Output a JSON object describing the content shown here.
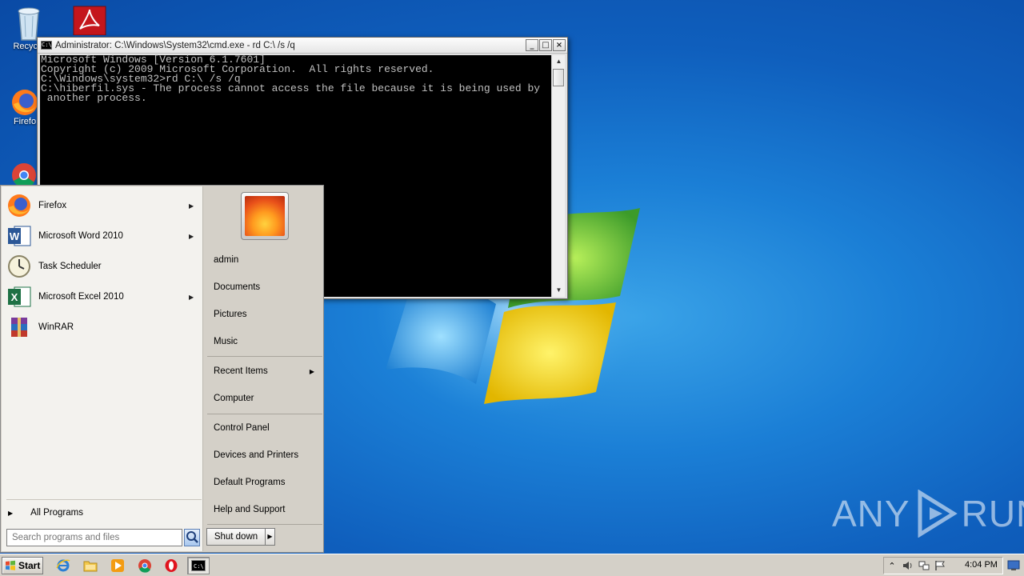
{
  "desktop": {
    "icons": [
      {
        "label": "Recycle"
      },
      {
        "label": "Firefo"
      }
    ],
    "watermark": {
      "left": "ANY",
      "right": "RUN"
    }
  },
  "cmd": {
    "title": "Administrator: C:\\Windows\\System32\\cmd.exe - rd  C:\\ /s /q",
    "controls": {
      "minimize": "_",
      "maximize": "□",
      "close": "×"
    },
    "lines": [
      "Microsoft Windows [Version 6.1.7601]",
      "Copyright (c) 2009 Microsoft Corporation.  All rights reserved.",
      "",
      "C:\\Windows\\system32>rd C:\\ /s /q",
      "C:\\hiberfil.sys - The process cannot access the file because it is being used by",
      " another process."
    ]
  },
  "start_menu": {
    "programs": [
      {
        "label": "Firefox",
        "icon": "firefox-icon",
        "submenu": true
      },
      {
        "label": "Microsoft Word 2010",
        "icon": "word-icon",
        "submenu": true
      },
      {
        "label": "Task Scheduler",
        "icon": "task-scheduler-icon",
        "submenu": false
      },
      {
        "label": "Microsoft Excel 2010",
        "icon": "excel-icon",
        "submenu": true
      },
      {
        "label": "WinRAR",
        "icon": "winrar-icon",
        "submenu": false
      }
    ],
    "all_programs": "All Programs",
    "search_placeholder": "Search programs and files",
    "right": {
      "user": "admin",
      "documents": "Documents",
      "pictures": "Pictures",
      "music": "Music",
      "recent_items": "Recent Items",
      "computer": "Computer",
      "control_panel": "Control Panel",
      "devices_printers": "Devices and Printers",
      "default_programs": "Default Programs",
      "help_support": "Help and Support"
    },
    "shutdown": "Shut down"
  },
  "taskbar": {
    "start_label": "Start",
    "apps": [
      "ie-icon",
      "explorer-icon",
      "media-player-icon",
      "chrome-icon",
      "opera-icon",
      "cmd-icon"
    ],
    "clock": "4:04 PM"
  }
}
